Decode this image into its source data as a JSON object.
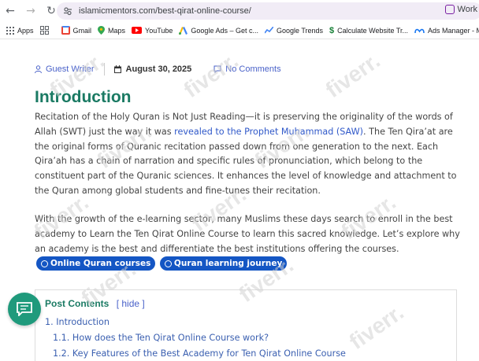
{
  "browser": {
    "url": "islamicmentors.com/best-qirat-online-course/",
    "ext_label": "Work",
    "bookmarks": [
      {
        "label": "Apps",
        "color": "#5f6368"
      },
      {
        "label": "Gmail",
        "color": "#ea4335"
      },
      {
        "label": "Maps",
        "color": "#34a853"
      },
      {
        "label": "YouTube",
        "color": "#ff0000"
      },
      {
        "label": "Google Ads – Get c...",
        "color": "#fbbc04"
      },
      {
        "label": "Google Trends",
        "color": "#4285f4"
      },
      {
        "label": "Calculate Website Tr...",
        "color": "#188038"
      },
      {
        "label": "Ads Manager - Man...",
        "color": "#1877f2"
      }
    ]
  },
  "post": {
    "author": "Guest Writer",
    "date": "August 30, 2025",
    "comments": "No Comments",
    "heading": "Introduction",
    "p1_a": "Recitation of the Holy Quran is Not Just Reading—it is preserving the originality of the words of Allah (SWT) just the way it was ",
    "p1_link": "revealed to the Prophet Muhammad (SAW)",
    "p1_b": ". The Ten Qira’at are the original forms of Quranic recitation passed down from one generation to the next. Each Qira’ah has a chain of narration and specific rules of pronunciation, which belong to the constituent part of the Quranic sciences. It enhances the level of knowledge and attachment to the Quran among global students and fine-tunes their recitation.",
    "p2": "With the growth of the e-learning sector, many Muslims these days search to enroll in the best academy to Learn the Ten Qirat Online Course to learn this sacred knowledge. Let’s explore why an academy is the best and differentiate the best institutions offering the courses.",
    "pill1": "Online Quran courses",
    "pill2": "Quran learning journey"
  },
  "toc": {
    "title": "Post Contents",
    "hide": "[ hide ]",
    "items": [
      "1. Introduction",
      "1.1. How does the Ten Qirat Online Course work?",
      "1.2. Key Features of the Best Academy for Ten Qirat Online Course"
    ]
  },
  "watermark": "fiverr."
}
